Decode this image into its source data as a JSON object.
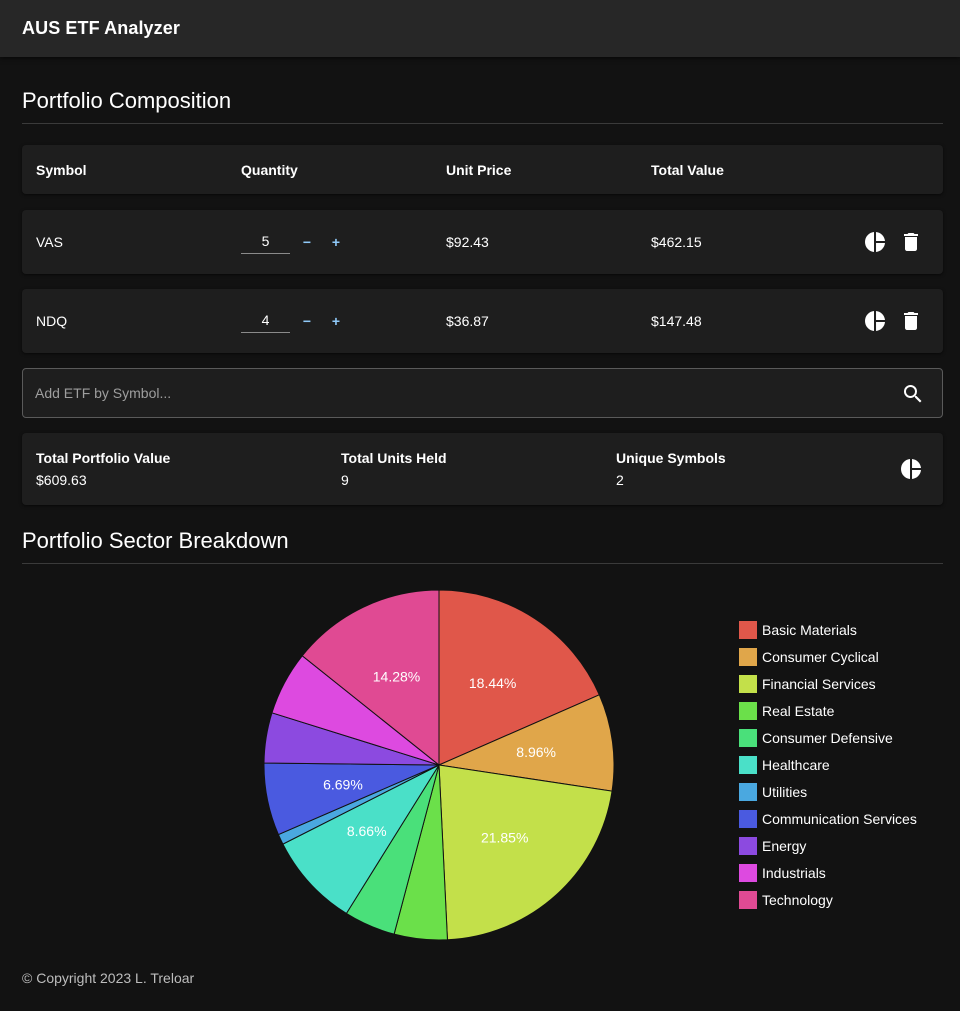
{
  "app": {
    "title": "AUS ETF Analyzer"
  },
  "composition": {
    "title": "Portfolio Composition",
    "headers": {
      "symbol": "Symbol",
      "quantity": "Quantity",
      "unit_price": "Unit Price",
      "total_value": "Total Value"
    },
    "rows": [
      {
        "symbol": "VAS",
        "quantity": "5",
        "unit_price": "$92.43",
        "total_value": "$462.15"
      },
      {
        "symbol": "NDQ",
        "quantity": "4",
        "unit_price": "$36.87",
        "total_value": "$147.48"
      }
    ],
    "stepper_minus": "−",
    "stepper_plus": "+"
  },
  "search": {
    "placeholder": "Add ETF by Symbol..."
  },
  "summary": {
    "total_value_label": "Total Portfolio Value",
    "total_value": "$609.63",
    "units_label": "Total Units Held",
    "units": "9",
    "symbols_label": "Unique Symbols",
    "symbols": "2"
  },
  "sector": {
    "title": "Portfolio Sector Breakdown"
  },
  "chart_data": {
    "type": "pie",
    "categories": [
      "Basic Materials",
      "Consumer Cyclical",
      "Financial Services",
      "Real Estate",
      "Consumer Defensive",
      "Healthcare",
      "Utilities",
      "Communication Services",
      "Energy",
      "Industrials",
      "Technology"
    ],
    "values": [
      18.44,
      8.96,
      21.85,
      4.9,
      4.75,
      8.66,
      0.96,
      6.69,
      4.64,
      5.91,
      14.28
    ],
    "colors": [
      "#e0574a",
      "#e0a64a",
      "#c3e04a",
      "#6be04a",
      "#4ae07a",
      "#4ae0c8",
      "#4aa8e0",
      "#4a5ae0",
      "#8c4ae0",
      "#dd4ae0",
      "#e04a93"
    ],
    "labels": [
      "18.44%",
      "8.96%",
      "21.85%",
      "",
      "",
      "8.66%",
      "",
      "6.69%",
      "",
      "",
      "14.28%"
    ],
    "legend_position": "right"
  },
  "footer": {
    "copyright": "© Copyright 2023 L. Treloar"
  }
}
